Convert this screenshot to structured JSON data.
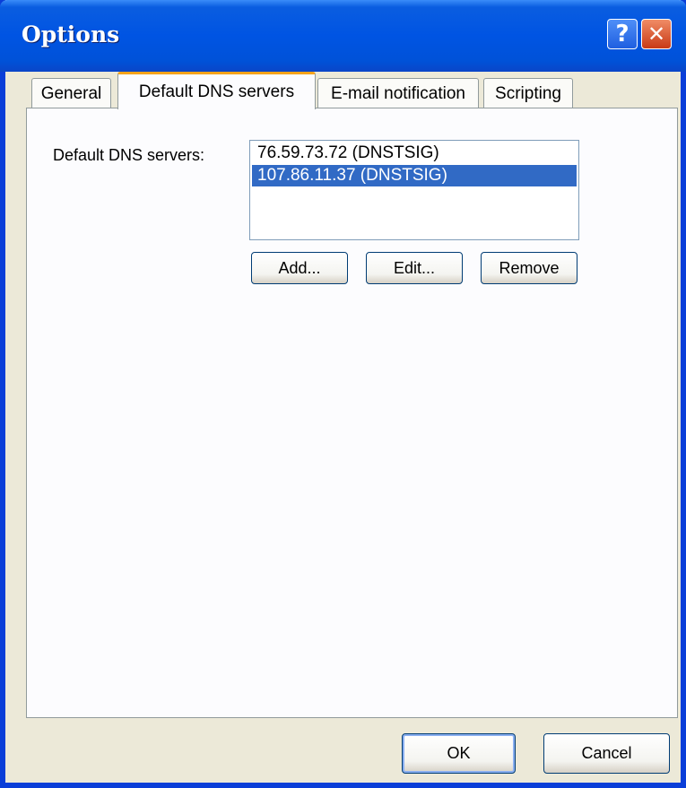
{
  "window": {
    "title": "Options"
  },
  "titlebar": {
    "help_glyph": "?",
    "close_glyph": "✕"
  },
  "tabs": [
    {
      "label": "General",
      "active": false
    },
    {
      "label": "Default DNS servers",
      "active": true
    },
    {
      "label": "E-mail notification",
      "active": false
    },
    {
      "label": "Scripting",
      "active": false
    }
  ],
  "dns_panel": {
    "label": "Default DNS servers:",
    "servers": [
      {
        "text": "76.59.73.72 (DNSTSIG)",
        "selected": false
      },
      {
        "text": "107.86.11.37 (DNSTSIG)",
        "selected": true
      }
    ],
    "add_label": "Add...",
    "edit_label": "Edit...",
    "remove_label": "Remove"
  },
  "footer": {
    "ok_label": "OK",
    "cancel_label": "Cancel"
  },
  "colors": {
    "titlebar": "#0054e3",
    "selection": "#316ac5",
    "dialog_bg": "#ece9d8",
    "active_tab_accent": "#f5a31b"
  }
}
